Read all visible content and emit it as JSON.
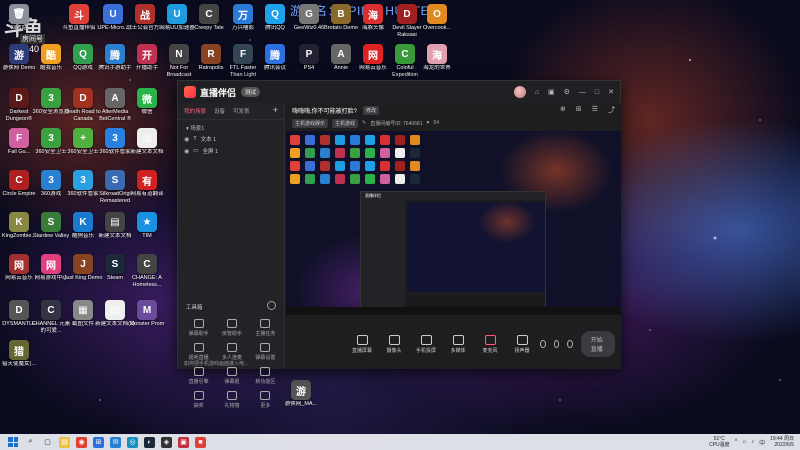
{
  "desktop": {
    "watermark_title": "游戏名：SPIRIT HUNTERS",
    "logo_text": "斗鱼",
    "logo_sub": "房间号",
    "logo_num": "640",
    "icons": [
      {
        "label": "回收站",
        "color": "#8a8f9a",
        "glyph": "🗑"
      },
      {
        "label": "斗鱼直播伴侣",
        "color": "#e0403a",
        "glyph": "斗"
      },
      {
        "label": "UPE-Micro...",
        "color": "#3a6fd8",
        "glyph": "U"
      },
      {
        "label": "战士公会官方...",
        "color": "#b0302c",
        "glyph": "战"
      },
      {
        "label": "网易UU加速器",
        "color": "#1f9be0",
        "glyph": "U"
      },
      {
        "label": "Creepy Tale",
        "color": "#444",
        "glyph": "C"
      },
      {
        "label": "万兴喵影",
        "color": "#2a7ad8",
        "glyph": "万"
      },
      {
        "label": "腾讯QQ",
        "color": "#1ea0ea",
        "glyph": "Q"
      },
      {
        "label": "GeeWiz0.46",
        "color": "#777",
        "glyph": "G"
      },
      {
        "label": "Brotato Demo",
        "color": "#8a6a2a",
        "glyph": "B"
      },
      {
        "label": "海豚头像",
        "color": "#d83030",
        "glyph": "海"
      },
      {
        "label": "Devil Slayer Raksasi",
        "color": "#a02020",
        "glyph": "D"
      },
      {
        "label": "Overcook...",
        "color": "#e08a20",
        "glyph": "O"
      },
      {
        "label": "游侠网 Demo",
        "color": "#2e3c7a",
        "glyph": "游"
      },
      {
        "label": "酷我音乐",
        "color": "#f0a020",
        "glyph": "酷"
      },
      {
        "label": "QQ游戏",
        "color": "#30a050",
        "glyph": "Q"
      },
      {
        "label": "腾讯手游助手",
        "color": "#2a80d0",
        "glyph": "腾"
      },
      {
        "label": "开播助手",
        "color": "#c03050",
        "glyph": "开"
      },
      {
        "label": "Not For Broadcast",
        "color": "#444",
        "glyph": "N"
      },
      {
        "label": "Ratropolis",
        "color": "#884422",
        "glyph": "R"
      },
      {
        "label": "FTL Faster Than Light",
        "color": "#345",
        "glyph": "F"
      },
      {
        "label": "腾讯会议",
        "color": "#2a70e0",
        "glyph": "腾"
      },
      {
        "label": "PS4",
        "color": "#223",
        "glyph": "P"
      },
      {
        "label": "Annie",
        "color": "#666",
        "glyph": "A"
      },
      {
        "label": "网易云音乐",
        "color": "#d22",
        "glyph": "网"
      },
      {
        "label": "Coloful Expedition",
        "color": "#3a9a3a",
        "glyph": "C"
      },
      {
        "label": "海龙的世界",
        "color": "#e0a0b0",
        "glyph": "海"
      },
      {
        "label": "Darkest Dungeon®",
        "color": "#5a1a1a",
        "glyph": "D"
      },
      {
        "label": "360安全浏览器",
        "color": "#3aa040",
        "glyph": "3"
      },
      {
        "label": "Death Road to Canada",
        "color": "#a03020",
        "glyph": "D"
      },
      {
        "label": "AlterMedia BetCentral ®",
        "color": "#666",
        "glyph": "A"
      },
      {
        "label": "微信",
        "color": "#2ab34a",
        "glyph": "微"
      },
      {
        "label": "Fall Gu...",
        "color": "#d060a0",
        "glyph": "F"
      },
      {
        "label": "360安全卫士",
        "color": "#3aa040",
        "glyph": "3"
      },
      {
        "label": "360安全卫士",
        "color": "#50b040",
        "glyph": "+"
      },
      {
        "label": "360软件管家",
        "color": "#2a80e0",
        "glyph": "3"
      },
      {
        "label": "新建文本文档",
        "color": "#eee",
        "glyph": "▤"
      },
      {
        "label": "Circle Empire",
        "color": "#b02020",
        "glyph": "C"
      },
      {
        "label": "360游戏",
        "color": "#2a80d0",
        "glyph": "3"
      },
      {
        "label": "360软件管家",
        "color": "#2aa0e0",
        "glyph": "3"
      },
      {
        "label": "SilkroadOrigi Remastered",
        "color": "#3a6ab0",
        "glyph": "S"
      },
      {
        "label": "网易有道翻译",
        "color": "#d02020",
        "glyph": "有"
      },
      {
        "label": "KingZombie...",
        "color": "#884",
        "glyph": "K"
      },
      {
        "label": "Stardew Valley",
        "color": "#3a7a3a",
        "glyph": "S"
      },
      {
        "label": "酷狗音乐",
        "color": "#1a7ad0",
        "glyph": "K"
      },
      {
        "label": "新建文本文档",
        "color": "#444",
        "glyph": "▤"
      },
      {
        "label": "TIM",
        "color": "#1a90e0",
        "glyph": "★"
      },
      {
        "label": "网易云音乐",
        "color": "#a03030",
        "glyph": "网"
      },
      {
        "label": "网易游戏中心",
        "color": "#e04080",
        "glyph": "网"
      },
      {
        "label": "Just King Demo",
        "color": "#884422",
        "glyph": "J"
      },
      {
        "label": "Steam",
        "color": "#1b2838",
        "glyph": "S"
      },
      {
        "label": "CHANGE: A Homeless...",
        "color": "#444",
        "glyph": "C"
      },
      {
        "label": "DYSMANTLE",
        "color": "#555",
        "glyph": "D"
      },
      {
        "label": "CHANNEL 元素的可爱...",
        "color": "#334",
        "glyph": "C"
      },
      {
        "label": "截图文件",
        "color": "#888",
        "glyph": "▦"
      },
      {
        "label": "新建文本文档(2)",
        "color": "#eee",
        "glyph": "▤"
      },
      {
        "label": "Monster Prom",
        "color": "#6a4a9a",
        "glyph": "M"
      },
      {
        "label": "猎天使魔女(...",
        "color": "#663",
        "glyph": "猎"
      },
      {
        "label": "游侠网_MA...",
        "color": "#555",
        "glyph": "游"
      }
    ]
  },
  "app": {
    "name": "直播伴侣",
    "version": "测试",
    "titlebar_icons": [
      "⌂",
      "▣",
      "⚙",
      "—",
      "□",
      "✕"
    ],
    "sidebar": {
      "tabs": [
        "我的场景",
        "设备",
        "可发表"
      ],
      "active_tab": "我的场景",
      "scene_group": "场景1",
      "scenes": [
        "文本 1",
        "全屏 1"
      ],
      "tools_title": "工具箱",
      "tools": [
        "弹幕助手",
        "房管助手",
        "主播任务",
        "视听直播",
        "多人连麦",
        "弹幕设置",
        "直播引擎",
        "弹幕姬",
        "新功能区",
        "抽奖",
        "礼物墙",
        "更多"
      ],
      "footer": "如何把手机游戏画面接入电..."
    },
    "room": {
      "title": "嗨嗨嗨,你不可能被打脸?",
      "edit_label": "修改",
      "tag1": "主机游戏娱乐",
      "tag2": "主机游戏",
      "room_info": "直播间编号ID: 7640681",
      "fans": "54",
      "icons": [
        "⊕",
        "⊞",
        "☰",
        "⤴"
      ]
    },
    "bottom_controls": [
      "直播屏幕",
      "摄像头",
      "手机投屏",
      "多媒体",
      "麦克风",
      "扬声器"
    ],
    "go_live": "开始直播"
  },
  "taskbar": {
    "icons": [
      "⌕",
      "▢",
      "▤",
      "◉",
      "⊞",
      "✉",
      "◎",
      "◐",
      "◈",
      "▣",
      "■"
    ],
    "weather_temp": "51°C",
    "weather_label": "CPU温度",
    "time": "19:44 周日",
    "date": "2022/6/5",
    "lang": "中"
  }
}
